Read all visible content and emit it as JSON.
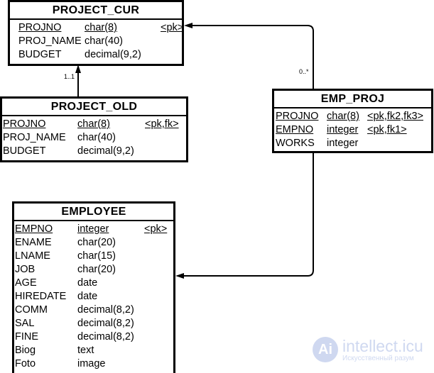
{
  "entities": [
    {
      "id": "project-cur",
      "title": "PROJECT_CUR",
      "cols": [
        15,
        108,
        215
      ],
      "rows": [
        [
          "PROJNO",
          "char(8)",
          "<pk>",
          true
        ],
        [
          "PROJ_NAME",
          "char(40)",
          "",
          false
        ],
        [
          "BUDGET",
          "decimal(9,2)",
          "",
          false
        ]
      ]
    },
    {
      "id": "project-old",
      "title": "PROJECT_OLD",
      "cols": [
        4,
        109,
        204
      ],
      "rows": [
        [
          "PROJNO",
          "char(8)",
          "<pk,fk>",
          true
        ],
        [
          "PROJ_NAME",
          "char(40)",
          "",
          false
        ],
        [
          "BUDGET",
          "decimal(9,2)",
          "",
          false
        ]
      ]
    },
    {
      "id": "emp-proj",
      "title": "EMP_PROJ",
      "cols": [
        5,
        77,
        134
      ],
      "rows": [
        [
          "PROJNO",
          "char(8)",
          "<pk,fk2,fk3>",
          true
        ],
        [
          "EMPNO",
          "integer",
          "<pk,fk1>",
          true
        ],
        [
          "WORKS",
          "integer",
          "",
          false
        ]
      ]
    },
    {
      "id": "employee",
      "title": "EMPLOYEE",
      "cols": [
        4,
        92,
        186
      ],
      "rows": [
        [
          "EMPNO",
          "integer",
          "<pk>",
          true
        ],
        [
          "ENAME",
          "char(20)",
          "",
          false
        ],
        [
          "LNAME",
          "char(15)",
          "",
          false
        ],
        [
          "JOB",
          "char(20)",
          "",
          false
        ],
        [
          "AGE",
          "date",
          "",
          false
        ],
        [
          "HIREDATE",
          "date",
          "",
          false
        ],
        [
          "COMM",
          "decimal(8,2)",
          "",
          false
        ],
        [
          "SAL",
          "decimal(8,2)",
          "",
          false
        ],
        [
          "FINE",
          "decimal(8,2)",
          "",
          false
        ],
        [
          "Biog",
          "text",
          "",
          false
        ],
        [
          "Foto",
          "image",
          "",
          false
        ]
      ]
    }
  ],
  "relations": {
    "old_to_cur": {
      "multiplicity": "1..1"
    },
    "empproj_to_cur": {
      "multiplicity": "0..*"
    }
  },
  "watermark": {
    "logo": "Ai",
    "name": "intellect.icu",
    "subtitle": "Искусственный разум"
  }
}
